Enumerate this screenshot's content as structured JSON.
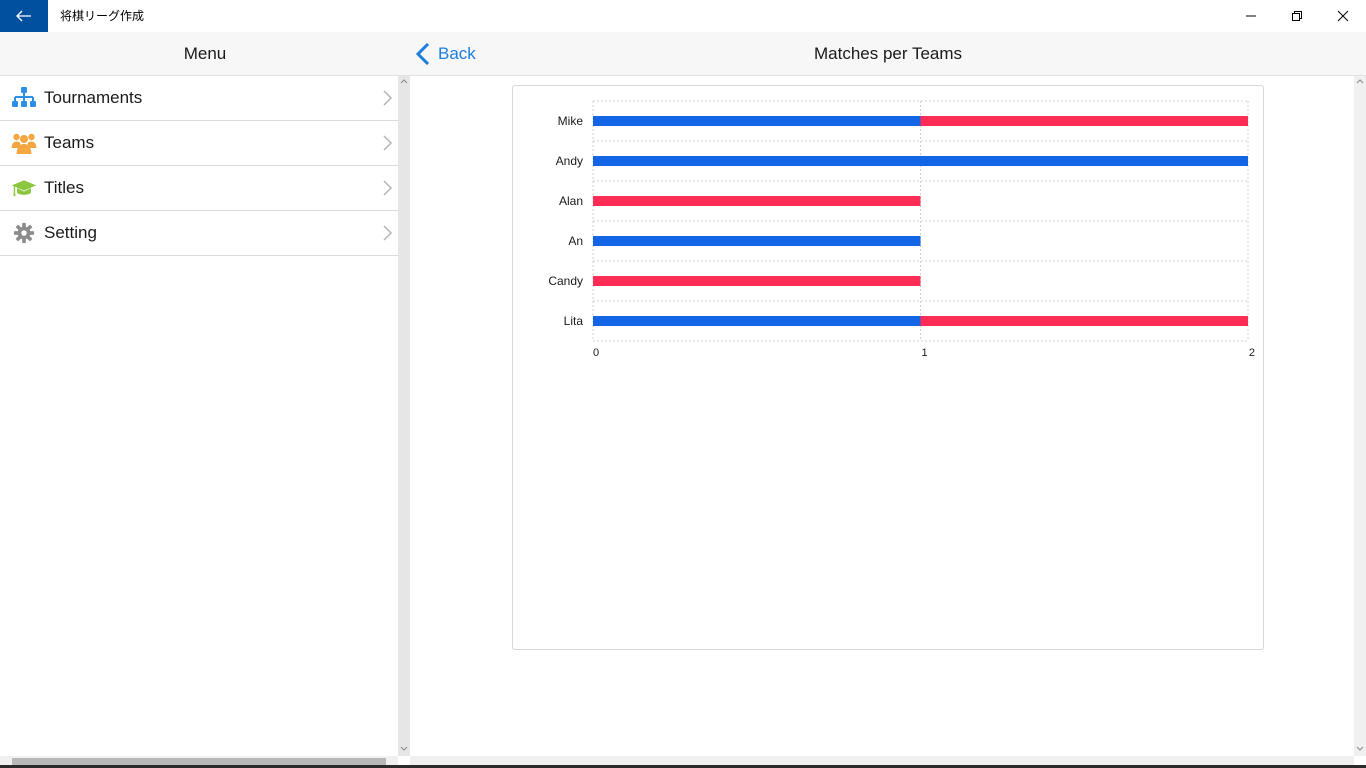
{
  "window": {
    "title": "将棋リーグ作成"
  },
  "left_pane": {
    "header": "Menu",
    "items": [
      {
        "label": "Tournaments",
        "icon": "tournament-tree-icon"
      },
      {
        "label": "Teams",
        "icon": "teams-icon"
      },
      {
        "label": "Titles",
        "icon": "graduation-cap-icon"
      },
      {
        "label": "Setting",
        "icon": "gear-icon"
      }
    ]
  },
  "right_pane": {
    "back_label": "Back",
    "title": "Matches per Teams"
  },
  "colors": {
    "accent": "#1b7fe0",
    "titlebar_back": "#0050a0",
    "series_blue": "#1464e6",
    "series_red": "#ff2d55"
  },
  "chart_data": {
    "type": "bar",
    "orientation": "horizontal",
    "stacked": true,
    "categories": [
      "Mike",
      "Andy",
      "Alan",
      "An",
      "Candy",
      "Lita"
    ],
    "series": [
      {
        "values": [
          1,
          2,
          0,
          1,
          0,
          1
        ],
        "color": "#1464e6"
      },
      {
        "values": [
          1,
          0,
          1,
          0,
          1,
          1
        ],
        "color": "#ff2d55"
      }
    ],
    "xlim": [
      0,
      2
    ],
    "xticks": [
      0,
      1,
      2
    ],
    "grid": true,
    "legend": "none"
  }
}
